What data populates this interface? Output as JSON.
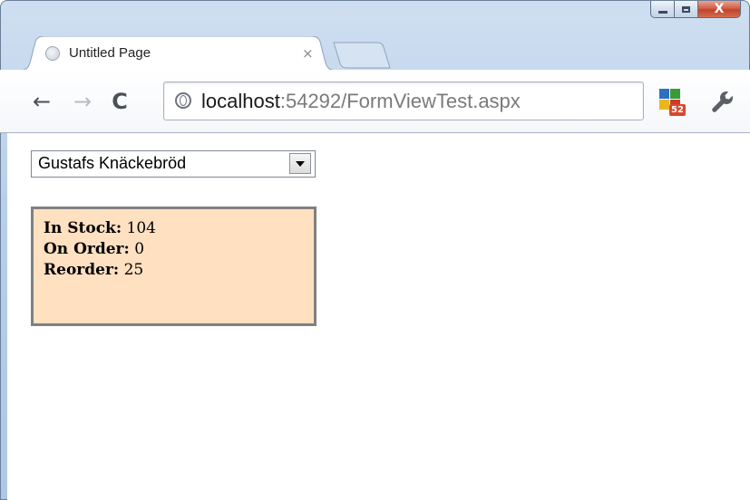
{
  "window": {
    "controls": {
      "minimize_icon": "minimize-icon",
      "maximize_icon": "maximize-icon",
      "close_glyph": "X"
    }
  },
  "tab": {
    "title": "Untitled Page",
    "close": "×",
    "favicon": "globe-icon"
  },
  "toolbar": {
    "back_glyph": "←",
    "forward_glyph": "→",
    "reload_glyph": "C",
    "url_host": "localhost",
    "url_rest": ":54292/FormViewTest.aspx",
    "extension_badge": "52",
    "extension_icon": "extension-icon",
    "wrench_icon": "wrench-icon"
  },
  "content": {
    "dropdown": {
      "selected": "Gustafs Knäckebröd"
    },
    "stock": {
      "in_stock_label": "In Stock:",
      "in_stock_value": "104",
      "on_order_label": "On Order:",
      "on_order_value": "0",
      "reorder_label": "Reorder:",
      "reorder_value": "25"
    }
  },
  "colors": {
    "stock_box_bg": "#ffe0c1",
    "stock_box_border": "#808080",
    "close_button": "#c0442b"
  }
}
